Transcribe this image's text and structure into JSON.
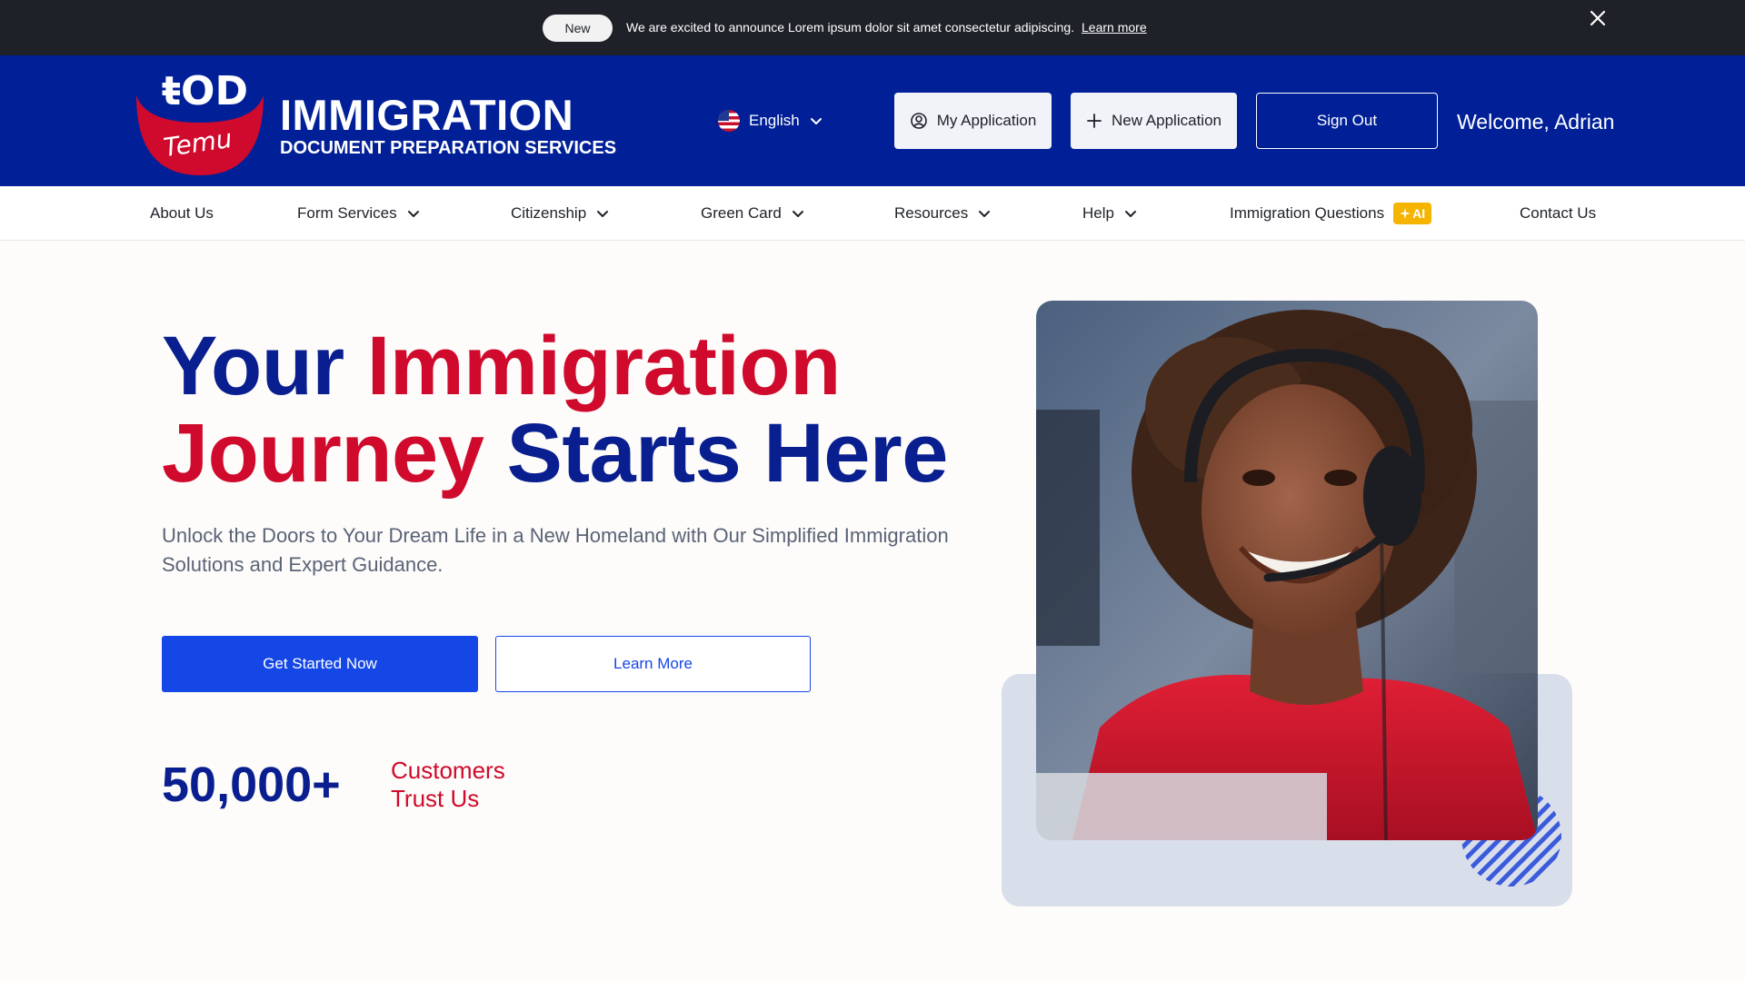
{
  "announcement": {
    "badge": "New",
    "message": "We are excited to announce Lorem ipsum dolor sit amet consectetur adipiscing.",
    "link": "Learn more",
    "close_icon": "close-icon"
  },
  "header": {
    "logo_text": "Temu",
    "title": "IMMIGRATION",
    "subtitle": "DOCUMENT PREPARATION SERVICES",
    "language": "English",
    "my_application": "My Application",
    "new_application": "New Application",
    "sign_out": "Sign Out",
    "welcome": "Welcome, Adrian"
  },
  "nav": {
    "items": [
      {
        "label": "About Us"
      },
      {
        "label": "Form Services"
      },
      {
        "label": "Citizenship"
      },
      {
        "label": "Green Card"
      },
      {
        "label": "Resources"
      },
      {
        "label": "Help"
      },
      {
        "label": "Immigration Questions"
      },
      {
        "label": "Contact Us"
      }
    ],
    "ai_badge": "AI"
  },
  "hero": {
    "title_word_1": "Your",
    "title_word_2": "Immigration",
    "title_word_3": "Journey",
    "title_word_4": "Starts Here",
    "description": "Unlock the Doors to Your Dream Life in a New Homeland with Our Simplified Immigration Solutions and Expert Guidance.",
    "cta_primary": "Get Started Now",
    "cta_secondary": "Learn More",
    "stat_number": "50,000+",
    "stat_label_line1": "Customers",
    "stat_label_line2": "Trust Us"
  },
  "colors": {
    "header_bg": "#012098",
    "announcement_bg": "#1e2128",
    "brand_red": "#cf0a2c",
    "brand_blue": "#0a1f8f",
    "primary_button": "#1447e6",
    "ai_badge": "#f4b400"
  }
}
